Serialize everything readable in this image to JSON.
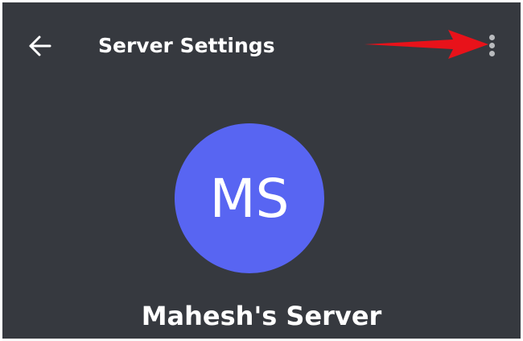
{
  "header": {
    "back_icon": "arrow-left-icon",
    "title": "Server Settings",
    "more_icon": "vertical-ellipsis-icon"
  },
  "server": {
    "initials": "MS",
    "name": "Mahesh's Server",
    "icon_color": "#5865f2"
  },
  "annotation": {
    "icon": "red-arrow-icon",
    "color": "#e8121a"
  },
  "colors": {
    "background": "#36393f",
    "text": "#ffffff",
    "icon_muted": "#b9bbbe"
  }
}
